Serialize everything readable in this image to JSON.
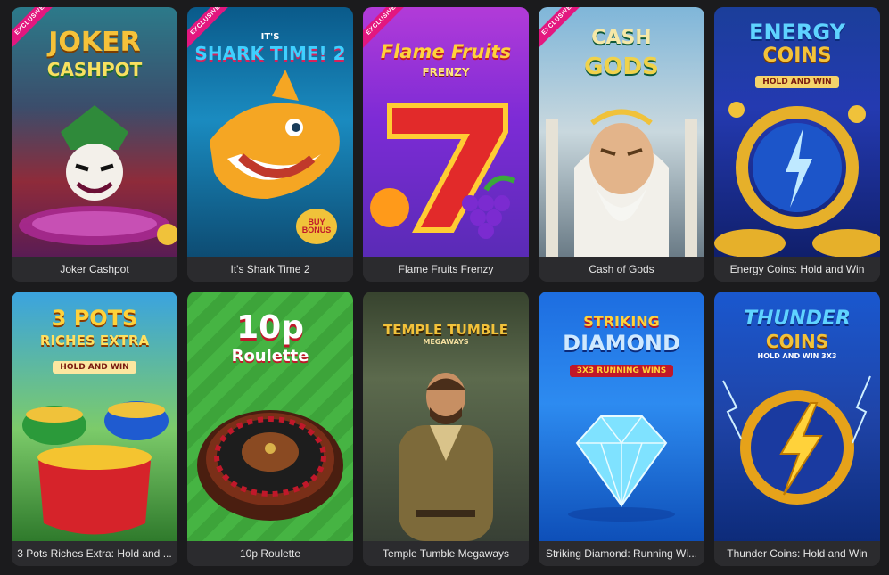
{
  "colors": {
    "page_bg": "#1b1b1d",
    "caption_bg": "#2b2b2e",
    "caption_text": "#e6e6e6",
    "exclusive_badge": "#e3177f"
  },
  "games": [
    {
      "title": "Joker Cashpot",
      "exclusive": true,
      "badge": "EXCLUSIVE",
      "logo_line1": "JOKER",
      "logo_line2": "CASHPOT"
    },
    {
      "title": "It's Shark Time 2",
      "exclusive": true,
      "badge": "EXCLUSIVE",
      "logo_line1": "IT'S",
      "logo_line2": "SHARK TIME! 2",
      "tag": "BUY BONUS"
    },
    {
      "title": "Flame Fruits Frenzy",
      "exclusive": true,
      "badge": "EXCLUSIVE",
      "logo_line1": "Flame Fruits",
      "logo_line2": "FRENZY"
    },
    {
      "title": "Cash of Gods",
      "exclusive": true,
      "badge": "EXCLUSIVE",
      "logo_line1": "CASH",
      "logo_line2": "GODS"
    },
    {
      "title": "Energy Coins: Hold and Win",
      "exclusive": false,
      "logo_line1": "ENERGY",
      "logo_line2": "COINS",
      "tag": "HOLD AND WIN"
    },
    {
      "title": "3 Pots Riches Extra: Hold and ...",
      "exclusive": false,
      "logo_line1": "3 POTS",
      "logo_line2": "RICHES EXTRA",
      "tag": "HOLD AND WIN"
    },
    {
      "title": "10p Roulette",
      "exclusive": false,
      "logo_line1": "10p",
      "logo_line2": "Roulette"
    },
    {
      "title": "Temple Tumble Megaways",
      "exclusive": false,
      "logo_line1": "TEMPLE TUMBLE",
      "logo_line2": "MEGAWAYS"
    },
    {
      "title": "Striking Diamond: Running Wi...",
      "exclusive": false,
      "logo_line1": "STRIKING",
      "logo_line2": "DIAMOND",
      "tag": "3X3 RUNNING WINS"
    },
    {
      "title": "Thunder Coins: Hold and Win",
      "exclusive": false,
      "logo_line1": "THUNDER",
      "logo_line2": "COINS",
      "tag": "HOLD AND WIN 3X3"
    }
  ]
}
